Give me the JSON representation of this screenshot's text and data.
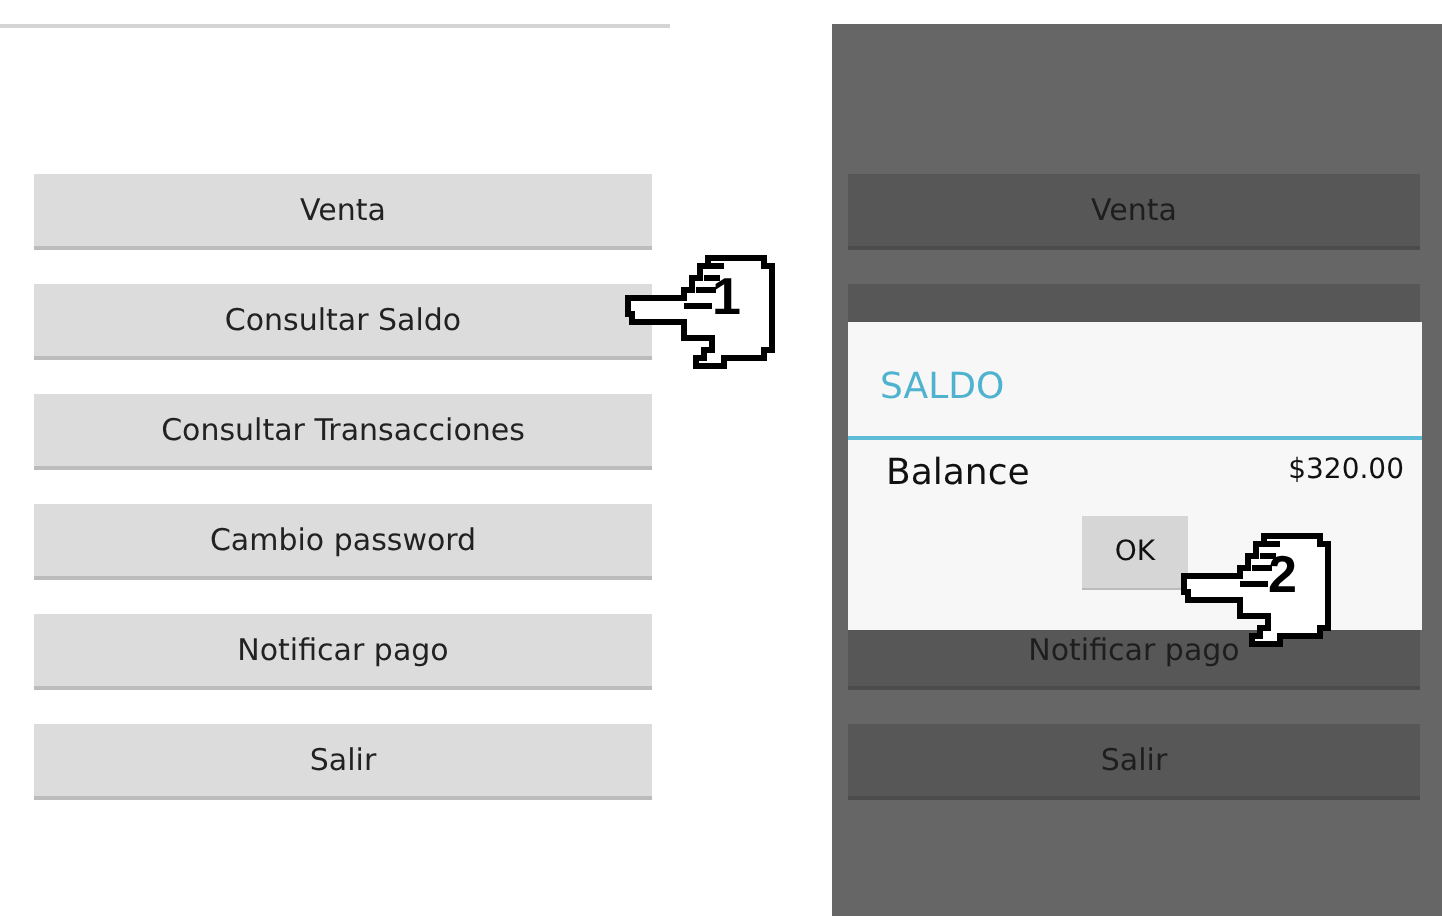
{
  "left_screen": {
    "buttons": [
      {
        "label": "Venta"
      },
      {
        "label": "Consultar Saldo"
      },
      {
        "label": "Consultar Transacciones"
      },
      {
        "label": "Cambio password"
      },
      {
        "label": "Notificar pago"
      },
      {
        "label": "Salir"
      }
    ]
  },
  "right_screen": {
    "buttons": [
      {
        "kind": "button",
        "label": "Venta"
      },
      {
        "kind": "covered"
      },
      {
        "kind": "hidden"
      },
      {
        "kind": "hidden"
      },
      {
        "kind": "button",
        "label": "Notificar pago"
      },
      {
        "kind": "button",
        "label": "Salir"
      }
    ],
    "dialog": {
      "title": "SALDO",
      "label": "Balance",
      "value": "$320.00",
      "ok_button": "OK"
    }
  },
  "annotations": [
    {
      "number": "1"
    },
    {
      "number": "2"
    }
  ]
}
